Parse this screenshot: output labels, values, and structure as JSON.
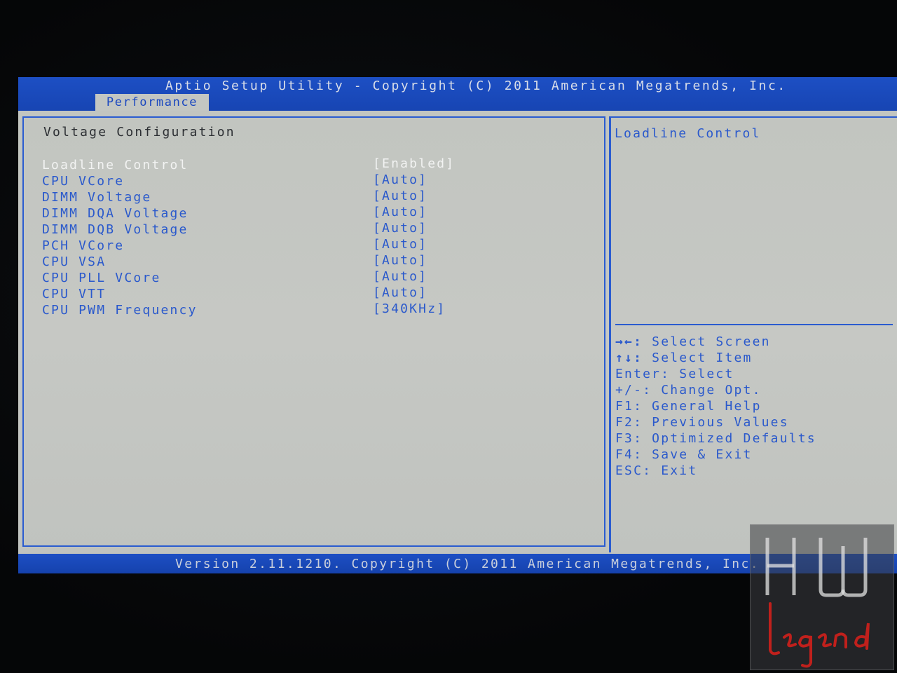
{
  "header": {
    "title": "Aptio Setup Utility - Copyright (C) 2011 American Megatrends, Inc.",
    "active_tab": "Performance"
  },
  "main": {
    "section_title": "Voltage Configuration",
    "settings": [
      {
        "label": "Loadline Control",
        "value": "[Enabled]",
        "selected": true
      },
      {
        "label": "CPU VCore",
        "value": "[Auto]"
      },
      {
        "label": "DIMM Voltage",
        "value": "[Auto]"
      },
      {
        "label": "DIMM DQA Voltage",
        "value": "[Auto]"
      },
      {
        "label": "DIMM DQB Voltage",
        "value": "[Auto]"
      },
      {
        "label": "PCH VCore",
        "value": "[Auto]"
      },
      {
        "label": "CPU VSA",
        "value": "[Auto]"
      },
      {
        "label": "CPU PLL VCore",
        "value": "[Auto]"
      },
      {
        "label": "CPU VTT",
        "value": "[Auto]"
      },
      {
        "label": "CPU PWM Frequency",
        "value": "[340KHz]"
      }
    ]
  },
  "help_panel": {
    "title": "Loadline Control",
    "keys": [
      {
        "key": "→←:",
        "desc": "Select Screen"
      },
      {
        "key": "↑↓:",
        "desc": "Select Item"
      },
      {
        "key": "Enter:",
        "desc": "Select"
      },
      {
        "key": "+/-:",
        "desc": "Change Opt."
      },
      {
        "key": "F1:",
        "desc": "General Help"
      },
      {
        "key": "F2:",
        "desc": "Previous Values"
      },
      {
        "key": "F3:",
        "desc": "Optimized Defaults"
      },
      {
        "key": "F4:",
        "desc": "Save & Exit"
      },
      {
        "key": "ESC:",
        "desc": "Exit"
      }
    ]
  },
  "footer": {
    "version": "Version 2.11.1210. Copyright (C) 2011 American Megatrends, Inc."
  },
  "watermark": {
    "text": "HW Legend"
  },
  "colors": {
    "bar_blue": "#1d4fc4",
    "panel_gray": "#c3c6c2",
    "text_blue": "#2a59cc",
    "selected_white": "#f2f3f2",
    "title_dark": "#2c2f33",
    "watermark_red": "#c0201c"
  }
}
